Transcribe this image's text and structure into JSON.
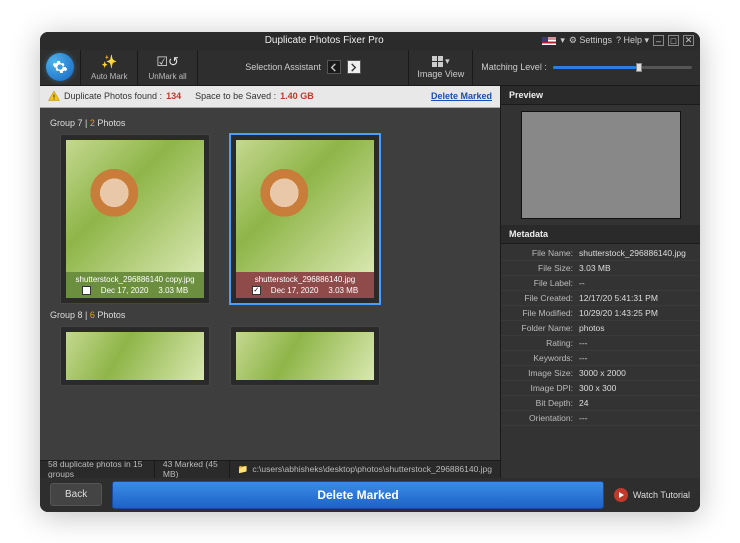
{
  "title": "Duplicate Photos Fixer Pro",
  "titlebar": {
    "settings": "⚙ Settings",
    "help": "? Help ▾",
    "lang": "▾"
  },
  "toolbar": {
    "automark": "Auto Mark",
    "unmarkall": "UnMark all",
    "selassist": "Selection Assistant",
    "imageview": "Image View",
    "matchlabel": "Matching Level :"
  },
  "infobar": {
    "dup_label": "Duplicate Photos found :",
    "dup_count": "134",
    "space_label": "Space to be Saved :",
    "space_val": "1.40 GB",
    "delete_marked": "Delete Marked"
  },
  "groups": [
    {
      "title": "Group 7 |",
      "count": "2",
      "count_suffix": "Photos",
      "items": [
        {
          "file": "shutterstock_296886140 copy.jpg",
          "date": "Dec 17, 2020",
          "size": "3.03 MB",
          "checked": false,
          "cap": "green"
        },
        {
          "file": "shutterstock_296886140.jpg",
          "date": "Dec 17, 2020",
          "size": "3.03 MB",
          "checked": true,
          "cap": "red",
          "selected": true
        }
      ]
    },
    {
      "title": "Group 8 |",
      "count": "6",
      "count_suffix": "Photos"
    }
  ],
  "side": {
    "preview": "Preview",
    "metadata": "Metadata",
    "rows": [
      {
        "k": "File Name:",
        "v": "shutterstock_296886140.jpg"
      },
      {
        "k": "File Size:",
        "v": "3.03 MB"
      },
      {
        "k": "File Label:",
        "v": "--"
      },
      {
        "k": "File Created:",
        "v": "12/17/20 5:41:31 PM"
      },
      {
        "k": "File Modified:",
        "v": "10/29/20 1:43:25 PM"
      },
      {
        "k": "Folder Name:",
        "v": "photos"
      },
      {
        "k": "Rating:",
        "v": "---"
      },
      {
        "k": "Keywords:",
        "v": "---"
      },
      {
        "k": "Image Size:",
        "v": "3000 x 2000"
      },
      {
        "k": "Image DPI:",
        "v": "300 x 300"
      },
      {
        "k": "Bit Depth:",
        "v": "24"
      },
      {
        "k": "Orientation:",
        "v": "---"
      }
    ]
  },
  "status": {
    "groups": "58 duplicate photos in 15 groups",
    "marked": "43 Marked (45 MB)",
    "path": "c:\\users\\abhisheks\\desktop\\photos\\shutterstock_296886140.jpg"
  },
  "bottom": {
    "back": "Back",
    "delete": "Delete Marked",
    "watch": "Watch Tutorial"
  }
}
